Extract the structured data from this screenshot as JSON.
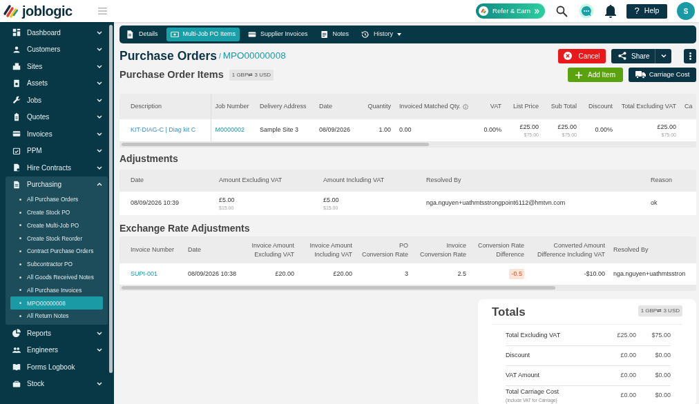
{
  "header": {
    "logo": "joblogic",
    "refer_button": "Refer & Earn",
    "help": {
      "icon": "?",
      "label": "Help"
    },
    "avatar": "S"
  },
  "sidebar": {
    "items": [
      {
        "label": "Dashboard",
        "expanded": false
      },
      {
        "label": "Customers",
        "expanded": false
      },
      {
        "label": "Sites",
        "expanded": false
      },
      {
        "label": "Assets",
        "expanded": false
      },
      {
        "label": "Jobs",
        "expanded": false
      },
      {
        "label": "Quotes",
        "expanded": false
      },
      {
        "label": "Invoices",
        "expanded": false
      },
      {
        "label": "PPM",
        "expanded": false
      },
      {
        "label": "Hire Contracts",
        "expanded": false
      },
      {
        "label": "Purchasing",
        "expanded": true,
        "children": [
          {
            "label": "All Purchase Orders",
            "selected": false
          },
          {
            "label": "Create Stock PO",
            "selected": false
          },
          {
            "label": "Create Multi-Job PO",
            "selected": false
          },
          {
            "label": "Create Stock Reorder",
            "selected": false
          },
          {
            "label": "Contract Purchase Orders",
            "selected": false
          },
          {
            "label": "Subcontractor PO",
            "selected": false
          },
          {
            "label": "All Goods Received Notes",
            "selected": false
          },
          {
            "label": "All Purchase Invoices",
            "selected": false
          },
          {
            "label": "MPO00000008",
            "selected": true
          },
          {
            "label": "All Return Notes",
            "selected": false
          }
        ]
      },
      {
        "label": "Reports",
        "expanded": false
      },
      {
        "label": "Engineers",
        "expanded": false
      },
      {
        "label": "Forms Logbook"
      },
      {
        "label": "Stock",
        "expanded": false
      }
    ]
  },
  "tabs": [
    {
      "label": "Details",
      "selected": false,
      "dropdown": false
    },
    {
      "label": "Multi-Job PO Items",
      "selected": true,
      "dropdown": false
    },
    {
      "label": "Supplier Invoices",
      "selected": false,
      "dropdown": false
    },
    {
      "label": "Notes",
      "selected": false,
      "dropdown": false
    },
    {
      "label": "History",
      "selected": false,
      "dropdown": true
    }
  ],
  "breadcrumb": {
    "title": "Purchase Orders",
    "separator": "/",
    "reference": "MPO00000008"
  },
  "actions": [
    {
      "kind": "cancel",
      "label": "Cancel"
    },
    {
      "kind": "share",
      "label": "Share"
    },
    {
      "kind": "more"
    }
  ],
  "items_section": {
    "title": "Purchase Order Items",
    "rate": "1 GBP⇄ 3 USD",
    "buttons": [
      {
        "kind": "add",
        "label": "Add Item"
      },
      {
        "kind": "carriage",
        "label": "Carriage Cost"
      }
    ],
    "table": {
      "columns": [
        {
          "label": "Description"
        },
        {
          "label": "Job Number"
        },
        {
          "label": "Delivery Address"
        },
        {
          "label": "Date"
        },
        {
          "label": "Quantity"
        },
        {
          "label": "Invoiced Matched Qty.",
          "info": true
        },
        {
          "label": "VAT"
        },
        {
          "label": "List Price"
        },
        {
          "label": "Sub Total"
        },
        {
          "label": "Discount"
        },
        {
          "label": "Total Excluding VAT"
        },
        {
          "label": "Ca"
        }
      ],
      "rows": [
        [
          {
            "text": "KIT-DIAG-C | Diag kit C",
            "kind": "link"
          },
          {
            "text": "M0000002",
            "kind": "reference"
          },
          {
            "text": "Sample Site 3"
          },
          {
            "text": "08/09/2026"
          },
          {
            "text": "1.00"
          },
          {
            "text": "0.00"
          },
          {
            "text": "0.00%"
          },
          {
            "text": "£25.00",
            "sub": "$75.00"
          },
          {
            "text": "£25.00",
            "sub": "$75.00"
          },
          {
            "text": "0.00%"
          },
          {
            "text": "£25.00",
            "sub": "$75.00"
          }
        ]
      ]
    }
  },
  "adjustments": {
    "title": "Adjustments",
    "table": {
      "columns": [
        {
          "label": "Date"
        },
        {
          "label": "Amount Excluding VAT"
        },
        {
          "label": "Amount Including VAT"
        },
        {
          "label": "Resolved By"
        },
        {
          "label": "Reason"
        }
      ],
      "rows": [
        [
          {
            "text": "08/09/2026 10:39"
          },
          {
            "text": "£5.00",
            "sub": "$15.00"
          },
          {
            "text": "£5.00",
            "sub": "$15.00"
          },
          {
            "text": "nga.nguyen+uathmtsstrongpoint6112@hmtvn.com"
          },
          {
            "text": "ok"
          }
        ]
      ]
    }
  },
  "exchange_rate_adjustments": {
    "title": "Exchange Rate Adjustments",
    "table": {
      "columns": [
        {
          "label": "Invoice Number"
        },
        {
          "label": "Date"
        },
        {
          "label": [
            "Invoice Amount",
            "Excluding VAT"
          ]
        },
        {
          "label": [
            "Invoice Amount",
            "Including VAT"
          ]
        },
        {
          "label": [
            "PO",
            "Conversion Rate"
          ]
        },
        {
          "label": [
            "Invoice",
            "Conversion Rate"
          ]
        },
        {
          "label": [
            "Conversion Rate",
            "Difference"
          ]
        },
        {
          "label": [
            "Converted Amount",
            "Difference Including VAT"
          ]
        },
        {
          "label": "Resolved By"
        }
      ],
      "rows": [
        [
          {
            "text": "SUPI-001",
            "kind": "reference"
          },
          {
            "text": "08/09/2026 10:38"
          },
          {
            "text": "£20.00"
          },
          {
            "text": "£20.00"
          },
          {
            "text": "3"
          },
          {
            "text": "2.5"
          },
          {
            "text": "-0.5",
            "kind": "badge"
          },
          {
            "text": "-$10.00"
          },
          {
            "text": "nga.nguyen+uathmtsstron"
          }
        ]
      ]
    }
  },
  "totals": {
    "title": "Totals",
    "rate": "1 GBP⇄ 3 USD",
    "rows": [
      {
        "label": "Total Excluding VAT",
        "gbp": "£25.00",
        "usd": "$75.00"
      },
      {
        "label": "Discount",
        "gbp": "£0.00",
        "usd": "$0.00"
      },
      {
        "label": "VAT Amount",
        "gbp": "£0.00",
        "usd": "$0.00"
      },
      {
        "label": "Total Carriage Cost",
        "note": "(Include VAT for Carriage)",
        "gbp": "£0.00",
        "usd": "$0.00"
      }
    ]
  }
}
